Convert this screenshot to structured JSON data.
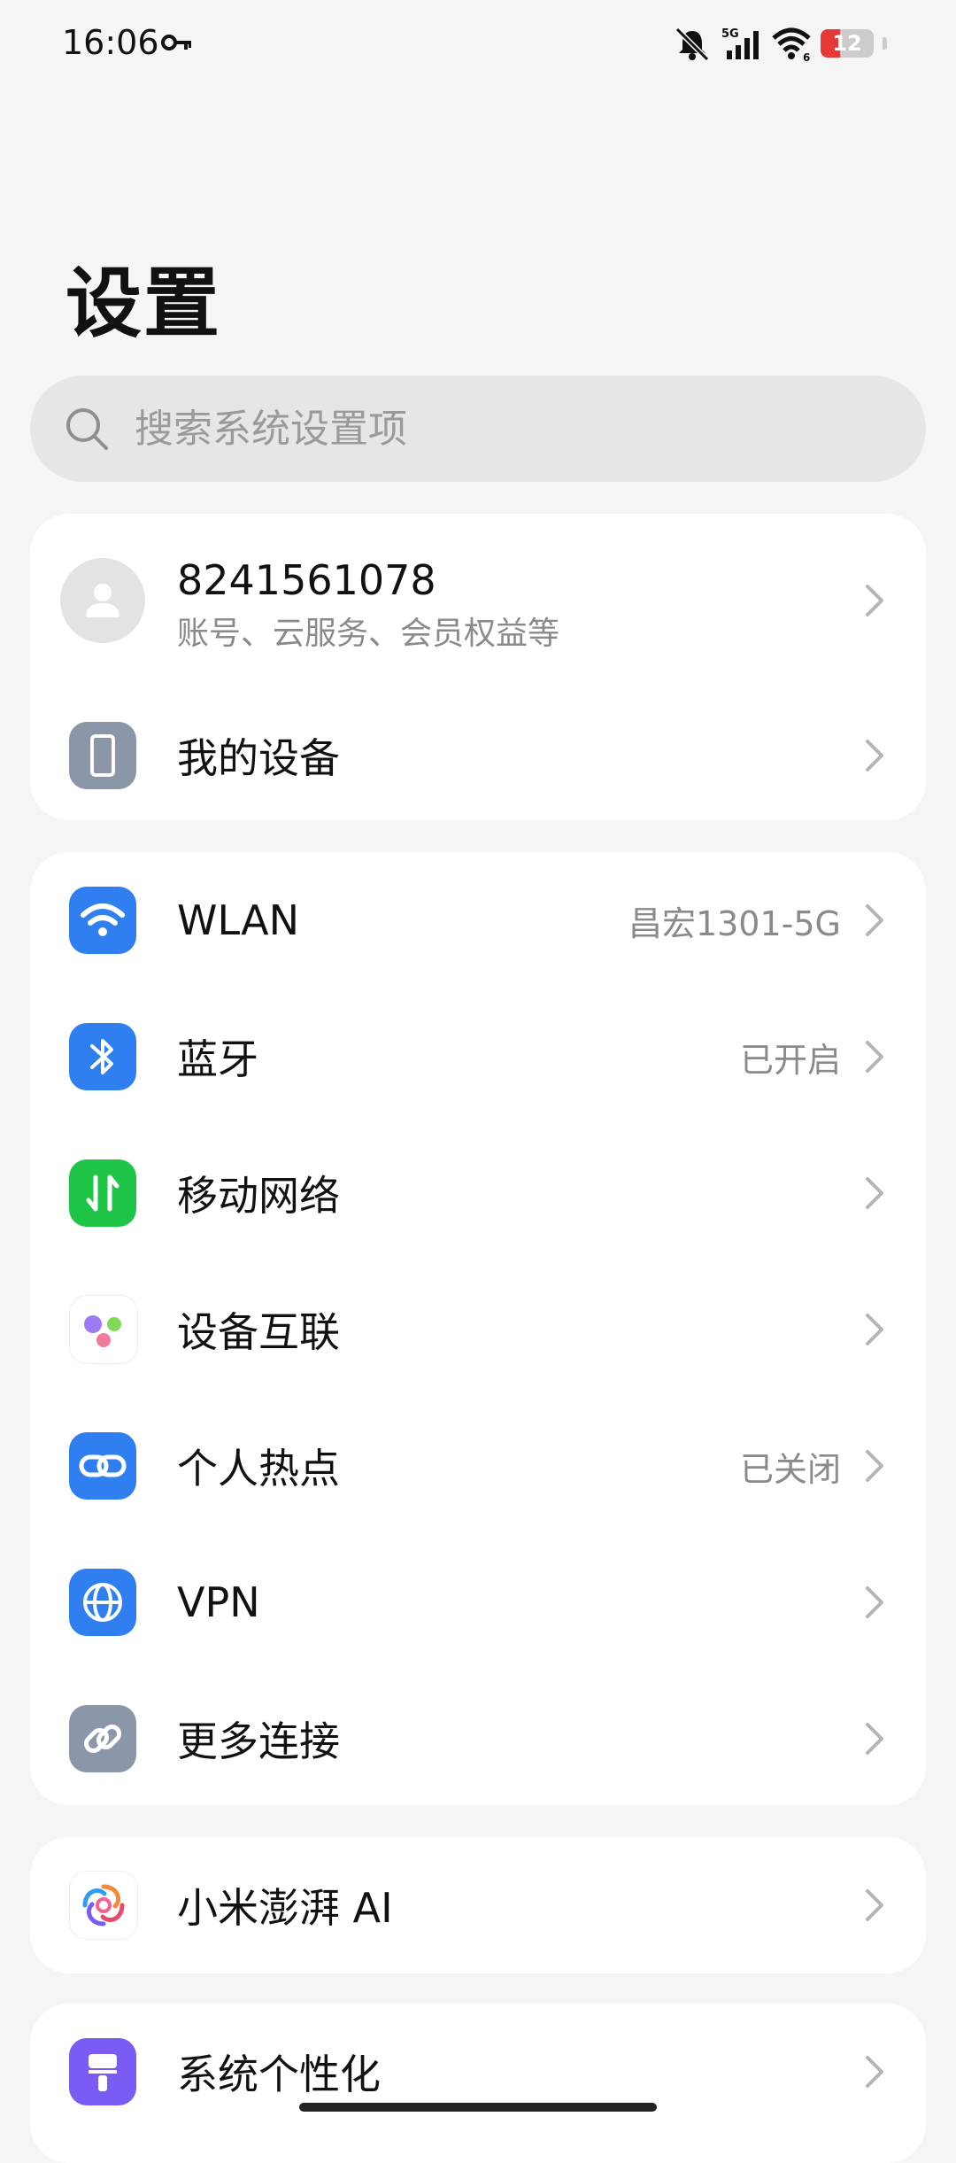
{
  "status_bar": {
    "time": "16:06",
    "battery": "12",
    "network": "5G",
    "wifi_badge": "6"
  },
  "page": {
    "title": "设置"
  },
  "search": {
    "placeholder": "搜索系统设置项"
  },
  "account": {
    "name": "8241561078",
    "subtitle": "账号、云服务、会员权益等"
  },
  "devices": {
    "label": "我的设备"
  },
  "connections": {
    "wlan": {
      "label": "WLAN",
      "value": "昌宏1301-5G"
    },
    "bluetooth": {
      "label": "蓝牙",
      "value": "已开启"
    },
    "mobile": {
      "label": "移动网络"
    },
    "interconnect": {
      "label": "设备互联"
    },
    "hotspot": {
      "label": "个人热点",
      "value": "已关闭"
    },
    "vpn": {
      "label": "VPN"
    },
    "more": {
      "label": "更多连接"
    }
  },
  "ai": {
    "label": "小米澎湃 AI"
  },
  "personalize": {
    "label": "系统个性化"
  },
  "colors": {
    "blue": "#2f7ff0",
    "green": "#1fc546",
    "gray": "#8b97a8",
    "purple": "#7a5cf5",
    "battery_low": "#e53935"
  }
}
